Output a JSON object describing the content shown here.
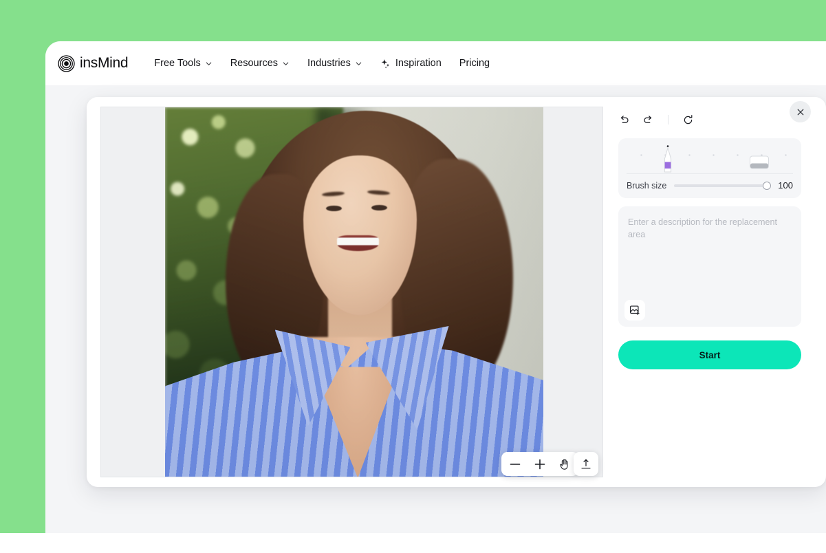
{
  "theme": {
    "backdrop_green": "#85e08c",
    "page_surface": "#f4f5f7",
    "accent_start": "#0ce6b8",
    "brush_purple": "#9b6ee0"
  },
  "navbar": {
    "brand_name": "insMind",
    "brand_icon": "concentric-circles-logo",
    "items": [
      {
        "label": "Free Tools",
        "has_chevron": true,
        "icon": "chevron-down-icon"
      },
      {
        "label": "Resources",
        "has_chevron": true,
        "icon": "chevron-down-icon"
      },
      {
        "label": "Industries",
        "has_chevron": true,
        "icon": "chevron-down-icon"
      },
      {
        "label": "Inspiration",
        "has_chevron": false,
        "icon": "sparkle-icon"
      },
      {
        "label": "Pricing",
        "has_chevron": false,
        "icon": ""
      }
    ]
  },
  "canvas": {
    "photo_alt": "smiling-woman-in-blue-striped-shirt",
    "zoom_toolbar": {
      "zoom_out_icon": "minus-icon",
      "zoom_in_icon": "plus-icon",
      "pan_icon": "hand-icon",
      "upload_icon": "upload-icon"
    }
  },
  "panel": {
    "history": {
      "undo_icon": "undo-icon",
      "redo_icon": "redo-icon",
      "reset_icon": "reset-icon"
    },
    "tools": {
      "brush_icon": "brush-pen-icon",
      "eraser_icon": "eraser-icon",
      "selected": "brush"
    },
    "brush_size": {
      "label": "Brush size",
      "value": "100",
      "min": 0,
      "max": 100
    },
    "description": {
      "placeholder": "Enter a description for the replacement area",
      "value": "",
      "add_image_icon": "add-image-icon"
    },
    "start_label": "Start",
    "close_icon": "close-icon"
  }
}
